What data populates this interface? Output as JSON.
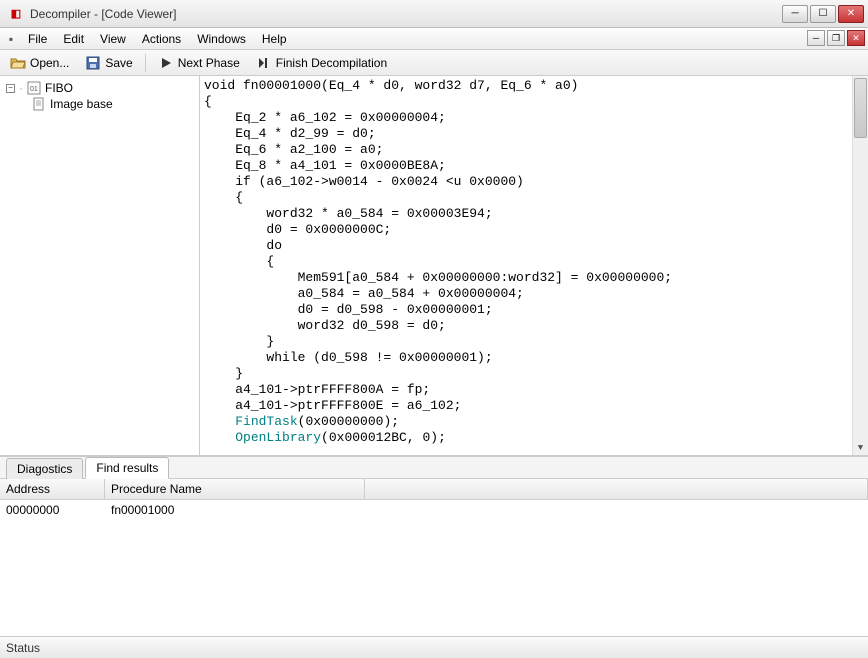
{
  "window": {
    "title": "Decompiler - [Code Viewer]"
  },
  "menu": {
    "items": [
      "File",
      "Edit",
      "View",
      "Actions",
      "Windows",
      "Help"
    ]
  },
  "toolbar": {
    "open": "Open...",
    "save": "Save",
    "next_phase": "Next Phase",
    "finish": "Finish Decompilation"
  },
  "tree": {
    "root": "FIBO",
    "child": "Image base"
  },
  "code": {
    "plain_before": "void fn00001000(Eq_4 * d0, word32 d7, Eq_6 * a0)\n{\n    Eq_2 * a6_102 = 0x00000004;\n    Eq_4 * d2_99 = d0;\n    Eq_6 * a2_100 = a0;\n    Eq_8 * a4_101 = 0x0000BE8A;\n    if (a6_102->w0014 - 0x0024 <u 0x0000)\n    {\n        word32 * a0_584 = 0x00003E94;\n        d0 = 0x0000000C;\n        do\n        {\n            Mem591[a0_584 + 0x00000000:word32] = 0x00000000;\n            a0_584 = a0_584 + 0x00000004;\n            d0 = d0_598 - 0x00000001;\n            word32 d0_598 = d0;\n        }\n        while (d0_598 != 0x00000001);\n    }\n    a4_101->ptrFFFF800A = fp;\n    a4_101->ptrFFFF800E = a6_102;\n    ",
    "fn1": "FindTask",
    "fn1_args": "(0x00000000);",
    "fn2": "OpenLibrary",
    "fn2_args": "(0x000012BC, 0);"
  },
  "bottom": {
    "tabs": {
      "diagnostics": "Diagostics",
      "find": "Find results"
    },
    "headers": {
      "address": "Address",
      "procname": "Procedure Name"
    },
    "rows": [
      {
        "address": "00000000",
        "procname": "fn00001000"
      }
    ]
  },
  "status": {
    "text": "Status"
  }
}
